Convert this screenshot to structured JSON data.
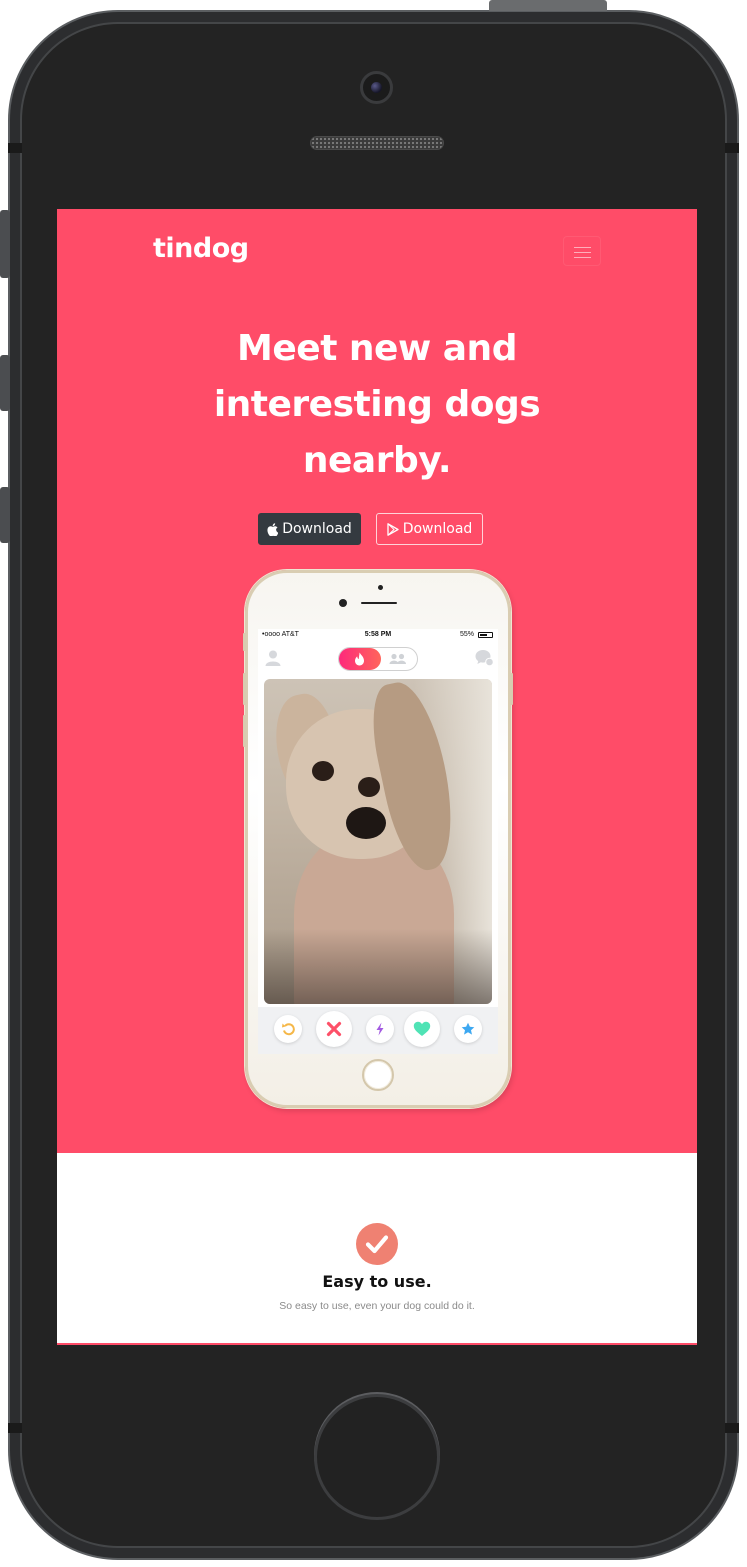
{
  "navbar": {
    "brand": "tindog",
    "menu_icon": "hamburger-icon"
  },
  "hero": {
    "headline_lines": [
      "Meet new and",
      "interesting dogs",
      "nearby."
    ],
    "buttons": [
      {
        "label": "Download",
        "icon": "apple-icon",
        "style": "dark"
      },
      {
        "label": "Download",
        "icon": "google-play-icon",
        "style": "outline"
      }
    ]
  },
  "mockup": {
    "status_bar": {
      "carrier": "•oooo AT&T",
      "time": "5:58 PM",
      "battery": "55%"
    },
    "actions": [
      "rewind-icon",
      "nope-icon",
      "boost-icon",
      "like-icon",
      "super-like-icon"
    ]
  },
  "features": [
    {
      "icon": "check-circle-icon",
      "title": "Easy to use.",
      "text": "So easy to use, even your dog could do it."
    }
  ],
  "colors": {
    "brand": "#ff4c68",
    "dark_button": "#343a40",
    "feature_icon": "#ef8172"
  }
}
